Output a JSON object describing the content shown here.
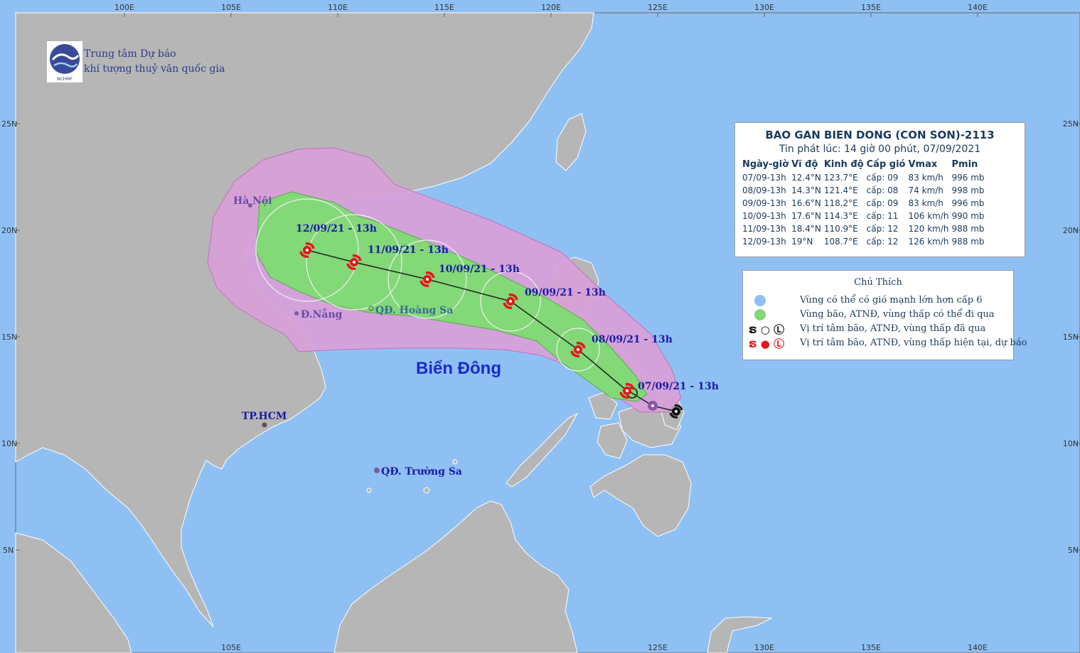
{
  "logo": {
    "line1": "Trung tâm Dự báo",
    "line2": "khí tượng thuỷ văn quốc gia",
    "abbr": "NCHMF"
  },
  "map": {
    "sea_name": "Biển Đông",
    "places": {
      "hanoi": "Hà Nội",
      "danang": "Đ.Nẵng",
      "hoangsa": "QĐ. Hoàng Sa",
      "hcm": "TP.HCM",
      "truongsa": "QĐ. Trường Sa"
    },
    "track_labels": [
      "07/09/21 - 13h",
      "08/09/21 - 13h",
      "09/09/21 - 13h",
      "10/09/21 - 13h",
      "11/09/21 - 13h",
      "12/09/21 - 13h"
    ],
    "lon_labels_top": [
      "100E",
      "105E",
      "110E",
      "115E",
      "120E",
      "125E",
      "130E",
      "135E",
      "140E"
    ],
    "lon_labels_bottom": [
      "105E",
      "125E",
      "130E",
      "135E",
      "140E"
    ],
    "lat_labels": [
      "25N",
      "20N",
      "15N",
      "10N",
      "5N"
    ],
    "colors": {
      "sea": "#8fc0f3",
      "land": "#b6b6b6",
      "danger_zone": "#d9a0d8",
      "storm_zone": "#83d877",
      "track_icon": "#e3171c"
    }
  },
  "info": {
    "title": "BAO GAN BIEN DONG (CON SON)-2113",
    "issued": "Tin phát lúc: 14 giờ 00 phút, 07/09/2021",
    "headers": [
      "Ngày-giờ",
      "Vĩ độ",
      "Kinh độ",
      "Cấp gió",
      "Vmax",
      "Pmin"
    ],
    "rows": [
      [
        "07/09-13h",
        "12.4°N",
        "123.7°E",
        "cấp: 09",
        "83 km/h",
        "996 mb"
      ],
      [
        "08/09-13h",
        "14.3°N",
        "121.4°E",
        "cấp: 08",
        "74 km/h",
        "998 mb"
      ],
      [
        "09/09-13h",
        "16.6°N",
        "118.2°E",
        "cấp: 09",
        "83 km/h",
        "996 mb"
      ],
      [
        "10/09-13h",
        "17.6°N",
        "114.3°E",
        "cấp: 11",
        "106 km/h",
        "990 mb"
      ],
      [
        "11/09-13h",
        "18.4°N",
        "110.9°E",
        "cấp: 12",
        "120 km/h",
        "988 mb"
      ],
      [
        "12/09-13h",
        "19°N",
        "108.7°E",
        "cấp: 12",
        "126 km/h",
        "988 mb"
      ]
    ]
  },
  "legend": {
    "title": "Chú Thích",
    "items": [
      "Vùng có thể có gió mạnh lớn hơn cấp 6",
      "Vùng bão, ATNĐ, vùng thấp có thể đi qua",
      "Vị trí tâm bão, ATNĐ, vùng thấp đã qua",
      "Vị trí tâm bão, ATNĐ, vùng thấp hiện tại, dự báo"
    ],
    "colors": {
      "wind": "#8fc0f3",
      "zone": "#83d877",
      "past": "#111111",
      "forecast": "#e3171c"
    }
  }
}
